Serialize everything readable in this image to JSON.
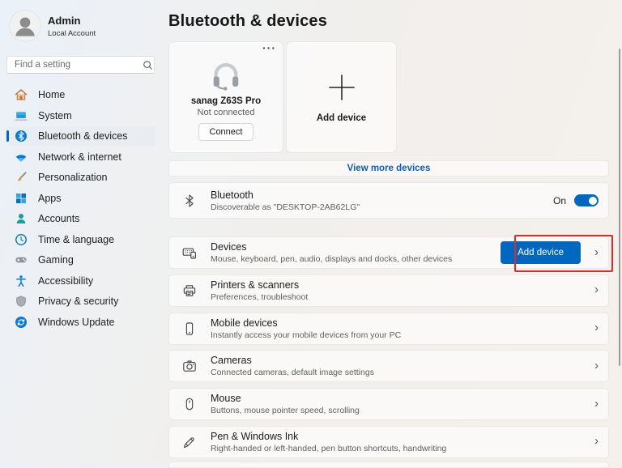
{
  "account": {
    "name": "Admin",
    "type": "Local Account"
  },
  "search": {
    "placeholder": "Find a setting"
  },
  "sidebar": {
    "items": [
      {
        "label": "Home",
        "icon": "home-icon"
      },
      {
        "label": "System",
        "icon": "system-icon"
      },
      {
        "label": "Bluetooth & devices",
        "icon": "bluetooth-icon",
        "selected": true
      },
      {
        "label": "Network & internet",
        "icon": "network-icon"
      },
      {
        "label": "Personalization",
        "icon": "personalization-icon"
      },
      {
        "label": "Apps",
        "icon": "apps-icon"
      },
      {
        "label": "Accounts",
        "icon": "accounts-icon"
      },
      {
        "label": "Time & language",
        "icon": "time-language-icon"
      },
      {
        "label": "Gaming",
        "icon": "gaming-icon"
      },
      {
        "label": "Accessibility",
        "icon": "accessibility-icon"
      },
      {
        "label": "Privacy & security",
        "icon": "privacy-icon"
      },
      {
        "label": "Windows Update",
        "icon": "windows-update-icon"
      }
    ]
  },
  "header": {
    "title": "Bluetooth & devices"
  },
  "cards": {
    "device": {
      "name": "sanag Z63S Pro",
      "status": "Not connected",
      "action": "Connect",
      "menu_icon": "···"
    },
    "add": {
      "label": "Add device",
      "plus_icon": "+"
    }
  },
  "view_more": {
    "label": "View more devices"
  },
  "bluetooth_row": {
    "title": "Bluetooth",
    "subtitle": "Discoverable as \"DESKTOP-2AB62LG\"",
    "toggle_label": "On",
    "toggle_state": "on"
  },
  "rows": [
    {
      "title": "Devices",
      "subtitle": "Mouse, keyboard, pen, audio, displays and docks, other devices",
      "button": "Add device"
    },
    {
      "title": "Printers & scanners",
      "subtitle": "Preferences, troubleshoot"
    },
    {
      "title": "Mobile devices",
      "subtitle": "Instantly access your mobile devices from your PC"
    },
    {
      "title": "Cameras",
      "subtitle": "Connected cameras, default image settings"
    },
    {
      "title": "Mouse",
      "subtitle": "Buttons, mouse pointer speed, scrolling"
    },
    {
      "title": "Pen & Windows Ink",
      "subtitle": "Right-handed or left-handed, pen button shortcuts, handwriting"
    }
  ],
  "icons": {
    "chevron": "›"
  },
  "colors": {
    "accent": "#0067c0",
    "link": "#0a5cc2",
    "highlight_red": "#e02a24"
  }
}
